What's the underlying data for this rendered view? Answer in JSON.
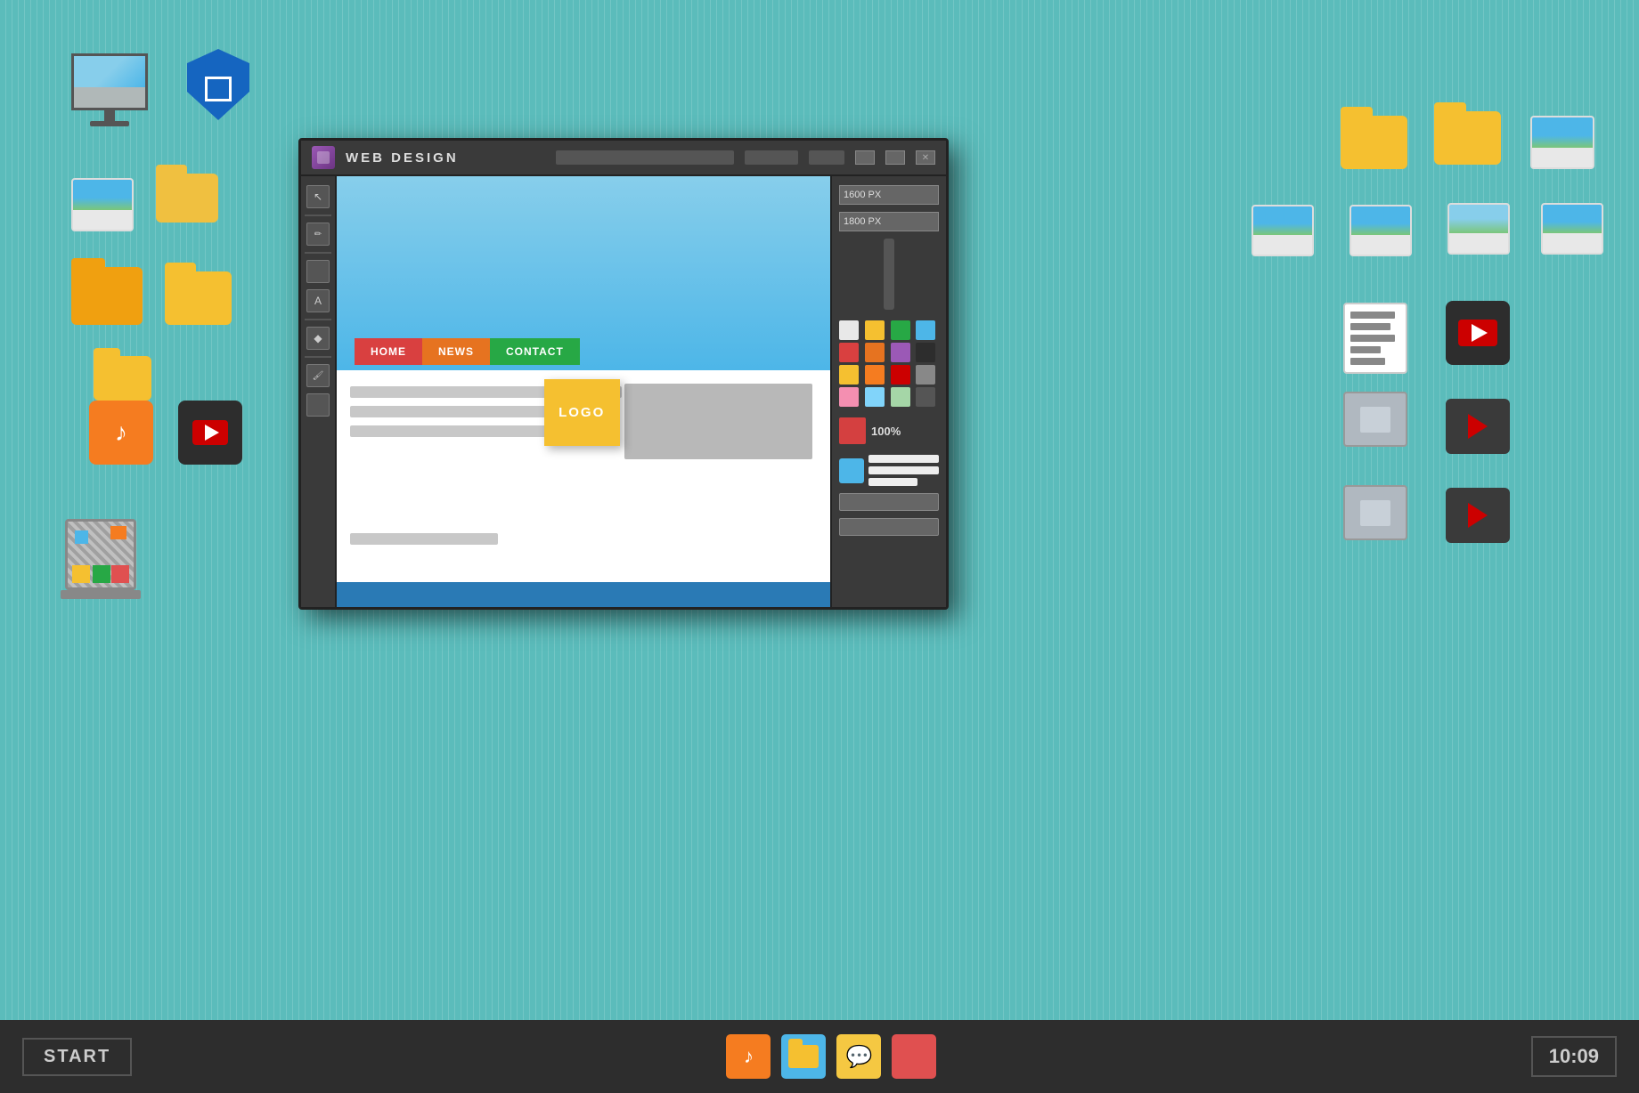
{
  "window": {
    "title": "WEB DESIGN",
    "controls": [
      "minimize",
      "maximize",
      "close"
    ],
    "dimension_w": "1600 PX",
    "dimension_h": "1800 PX",
    "zoom": "100%"
  },
  "nav_buttons": [
    {
      "label": "HOME",
      "color": "#d94040"
    },
    {
      "label": "NEWS",
      "color": "#e67320"
    },
    {
      "label": "CONTACT",
      "color": "#27a845"
    }
  ],
  "logo": "LOGO",
  "taskbar": {
    "start_label": "START",
    "time": "10:09"
  },
  "colors": {
    "desktop_bg": "#5bbcbb",
    "taskbar_bg": "#2d2d2d"
  },
  "swatches": [
    "#e8e8e8",
    "#f5c030",
    "#27a845",
    "#4db6e8",
    "#d94040",
    "#e67320",
    "#9b59b6",
    "#2d2d2d",
    "#f5c030",
    "#f57c20",
    "#cc0000",
    "#888888"
  ]
}
